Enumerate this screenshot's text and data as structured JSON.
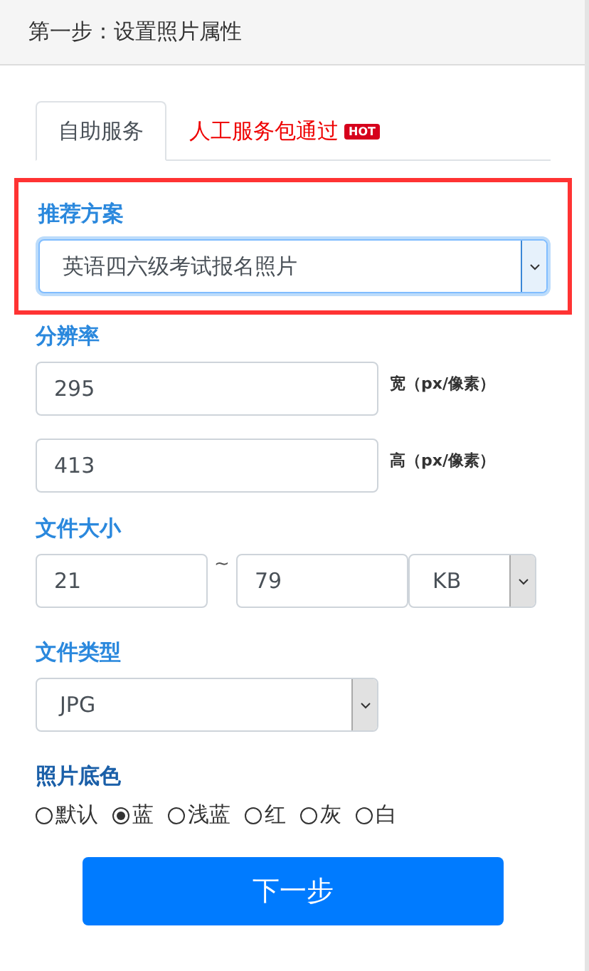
{
  "header": {
    "title": "第一步：设置照片属性"
  },
  "tabs": [
    {
      "label": "自助服务",
      "selected": true
    },
    {
      "label": "人工服务包通过",
      "selected": false,
      "badge": "HOT"
    }
  ],
  "preset": {
    "label": "推荐方案",
    "value": "英语四六级考试报名照片",
    "highlighted": true
  },
  "resolution": {
    "label": "分辨率",
    "fields": [
      {
        "value": "295",
        "unit": "宽（px/像素）"
      },
      {
        "value": "413",
        "unit": "高（px/像素）"
      }
    ]
  },
  "file_size": {
    "label": "文件大小",
    "min": "21",
    "separator": "~",
    "max": "79",
    "unit": "KB"
  },
  "file_type": {
    "label": "文件类型",
    "value": "JPG"
  },
  "background": {
    "label": "照片底色",
    "options": [
      {
        "label": "默认",
        "selected": false
      },
      {
        "label": "蓝",
        "selected": true
      },
      {
        "label": "浅蓝",
        "selected": false
      },
      {
        "label": "红",
        "selected": false
      },
      {
        "label": "灰",
        "selected": false
      },
      {
        "label": "白",
        "selected": false
      }
    ]
  },
  "next_button": "下一步"
}
